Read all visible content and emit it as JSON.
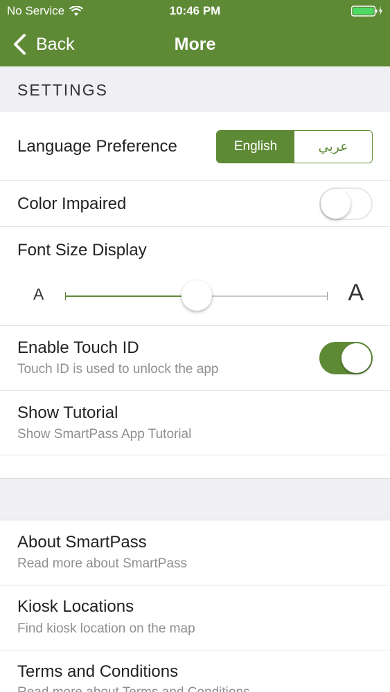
{
  "status_bar": {
    "carrier": "No Service",
    "time": "10:46 PM"
  },
  "nav": {
    "back_label": "Back",
    "title": "More"
  },
  "settings": {
    "header": "SETTINGS",
    "language": {
      "label": "Language Preference",
      "options": [
        "English",
        "عربي"
      ],
      "selected": "English"
    },
    "color_impaired": {
      "label": "Color Impaired",
      "enabled": false
    },
    "font_size": {
      "label": "Font Size Display",
      "small_label": "A",
      "large_label": "A",
      "level": 0.5
    },
    "touch_id": {
      "label": "Enable Touch ID",
      "subtitle": "Touch ID is used to unlock the app",
      "enabled": true
    },
    "tutorial": {
      "label": "Show Tutorial",
      "subtitle": "Show SmartPass App Tutorial"
    }
  },
  "info": {
    "items": [
      {
        "label": "About SmartPass",
        "subtitle": "Read more about SmartPass"
      },
      {
        "label": "Kiosk Locations",
        "subtitle": "Find kiosk location on the map"
      },
      {
        "label": "Terms and Conditions",
        "subtitle": "Read more about Terms and Conditions"
      }
    ]
  },
  "colors": {
    "accent": "#5e8a36",
    "section_bg": "#efeff4",
    "subtitle": "#8e8e93"
  }
}
